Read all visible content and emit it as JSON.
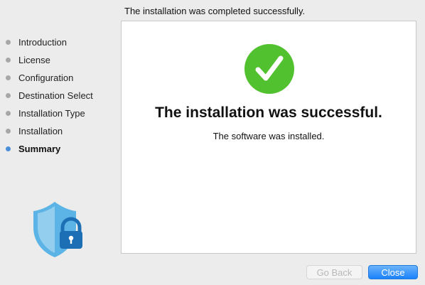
{
  "header": {
    "message": "The installation was completed successfully."
  },
  "sidebar": {
    "steps": [
      {
        "label": "Introduction",
        "active": false
      },
      {
        "label": "License",
        "active": false
      },
      {
        "label": "Configuration",
        "active": false
      },
      {
        "label": "Destination Select",
        "active": false
      },
      {
        "label": "Installation Type",
        "active": false
      },
      {
        "label": "Installation",
        "active": false
      },
      {
        "label": "Summary",
        "active": true
      }
    ],
    "logo_icon": "shield-lock-icon"
  },
  "main": {
    "status_icon": "checkmark-circle-icon",
    "title": "The installation was successful.",
    "subtitle": "The software was installed."
  },
  "footer": {
    "back_label": "Go Back",
    "back_enabled": false,
    "close_label": "Close"
  },
  "colors": {
    "success_green": "#52c130",
    "accent_blue": "#1a82fb",
    "active_dot": "#4a90d9",
    "shield_blue": "#5bb4e5",
    "lock_blue": "#1d6fb5"
  }
}
